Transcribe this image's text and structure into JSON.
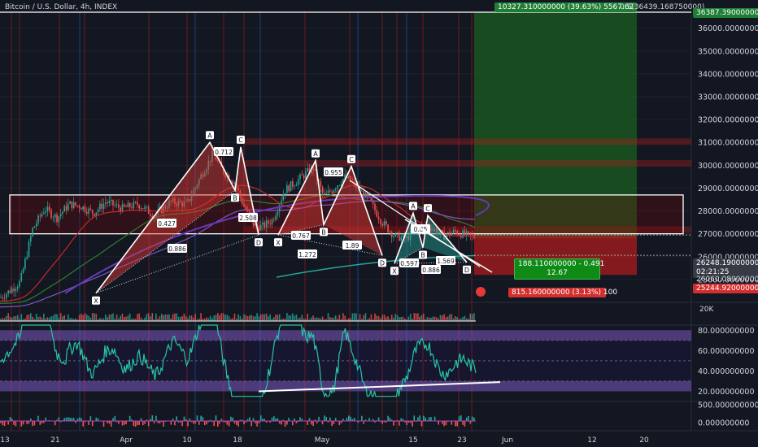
{
  "chart": {
    "title": "Bitcoin / U.S. Dollar, 4h, INDEX",
    "top_measure": "10327.310000000 (39.63%) 5567.62",
    "top_fib": "0.5(36439.168750000)",
    "top_price": "36387.390000000",
    "target_box_line1": "188.110000000 - 0.491",
    "target_box_line2": "12.67",
    "stop_box": "815.160000000 (3.13%) 100",
    "last_price": "26248.190000000",
    "countdown": "02:21:25",
    "white_line_price": "26060.080000000",
    "stop_price": "25244.920000000",
    "volume_label": "20K",
    "colors": {
      "background": "#131722",
      "up": "#26a69a",
      "down": "#ef5350",
      "pattern": "#e53935",
      "green_zone": "#1b5e20",
      "red_zone": "#b71c1c",
      "rsi": "#26c6a6",
      "rsi_band": "#7e57c2"
    }
  },
  "price_axis": [
    "36000.000000000",
    "35000.000000000",
    "34000.000000000",
    "33000.000000000",
    "32000.000000000",
    "31000.000000000",
    "30000.000000000",
    "29000.000000000",
    "28000.000000000",
    "27000.000000000",
    "26000.000000000",
    "25000.000000000"
  ],
  "rsi_axis": [
    "80.000000000",
    "60.000000000",
    "40.000000000",
    "20.000000000"
  ],
  "macd_axis": [
    "500.000000000",
    "0.000000000"
  ],
  "time_axis": [
    "13",
    "21",
    "Apr",
    "10",
    "18",
    "May",
    "15",
    "23",
    "Jun",
    "12",
    "20"
  ],
  "pattern_labels": {
    "points": [
      "X",
      "A",
      "B",
      "C",
      "D",
      "X",
      "A",
      "B",
      "C",
      "D",
      "X",
      "A",
      "B",
      "C",
      "D"
    ],
    "ratios": [
      "0.427",
      "0.712",
      "2.508",
      "0.886",
      "0.767",
      "0.955",
      "1.89",
      "1.272",
      "0.597",
      "0.85",
      "1.569",
      "0.886"
    ]
  },
  "chart_data": {
    "type": "candlestick",
    "title": "Bitcoin / U.S. Dollar, 4h, INDEX",
    "y_range": [
      25000,
      36400
    ],
    "x_ticks": [
      "13",
      "21",
      "Apr",
      "10",
      "18",
      "May",
      "15",
      "23",
      "Jun",
      "12",
      "20"
    ],
    "close_path": [
      [
        0,
        24200
      ],
      [
        12,
        24500
      ],
      [
        25,
        24900
      ],
      [
        40,
        27200
      ],
      [
        55,
        28100
      ],
      [
        70,
        27700
      ],
      [
        85,
        28300
      ],
      [
        100,
        28200
      ],
      [
        115,
        27900
      ],
      [
        130,
        28400
      ],
      [
        150,
        28100
      ],
      [
        170,
        28300
      ],
      [
        190,
        27800
      ],
      [
        210,
        28400
      ],
      [
        230,
        28300
      ],
      [
        248,
        29600
      ],
      [
        262,
        30500
      ],
      [
        275,
        29700
      ],
      [
        288,
        29300
      ],
      [
        300,
        28200
      ],
      [
        312,
        27400
      ],
      [
        322,
        27300
      ],
      [
        335,
        27600
      ],
      [
        350,
        28900
      ],
      [
        368,
        29400
      ],
      [
        385,
        29900
      ],
      [
        398,
        28600
      ],
      [
        410,
        29000
      ],
      [
        425,
        29500
      ],
      [
        440,
        29000
      ],
      [
        455,
        28400
      ],
      [
        470,
        27500
      ],
      [
        485,
        26900
      ],
      [
        500,
        26800
      ],
      [
        515,
        27300
      ],
      [
        530,
        27300
      ],
      [
        545,
        26900
      ],
      [
        560,
        27100
      ],
      [
        575,
        26900
      ],
      [
        585,
        26850
      ]
    ],
    "harmonic_patterns": [
      {
        "X": 24400,
        "A": 31000,
        "B": 28900,
        "C": 30800,
        "D": 26950
      },
      {
        "X": 26950,
        "A": 30200,
        "B": 27400,
        "C": 29950,
        "D": 26050
      },
      {
        "X": 25700,
        "A": 27900,
        "B": 26400,
        "C": 27800,
        "D": 25750
      }
    ],
    "rsi_support_line": [
      [
        320,
        20
      ],
      [
        615,
        30
      ]
    ],
    "rsi_overbought": 70,
    "rsi_oversold": 30
  }
}
